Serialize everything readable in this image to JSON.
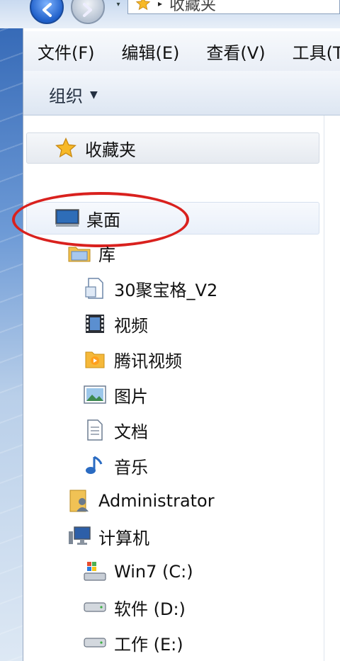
{
  "address": {
    "location": "收藏夹",
    "crumb_arrow": "▸",
    "drop_caret": "▾"
  },
  "menu": {
    "items": [
      {
        "label": "文件(F)"
      },
      {
        "label": "编辑(E)"
      },
      {
        "label": "查看(V)"
      },
      {
        "label": "工具(T"
      }
    ]
  },
  "toolbar": {
    "organize_label": "组织",
    "organize_caret": "▼"
  },
  "navpane": {
    "favorites": {
      "label": "收藏夹",
      "icon": "star-icon"
    },
    "items": [
      {
        "label": "桌面",
        "icon": "desktop-icon",
        "highlighted": true
      },
      {
        "label": "库",
        "icon": "library-folder-icon"
      },
      {
        "label": "30聚宝格_V2",
        "icon": "document-library-icon"
      },
      {
        "label": "视频",
        "icon": "video-icon"
      },
      {
        "label": "腾讯视频",
        "icon": "tencent-video-icon"
      },
      {
        "label": "图片",
        "icon": "picture-icon"
      },
      {
        "label": "文档",
        "icon": "document-icon"
      },
      {
        "label": "音乐",
        "icon": "music-icon"
      },
      {
        "label": "Administrator",
        "icon": "user-folder-icon"
      },
      {
        "label": "计算机",
        "icon": "computer-icon"
      },
      {
        "label": "Win7 (C:)",
        "icon": "system-drive-icon"
      },
      {
        "label": "软件 (D:)",
        "icon": "drive-icon"
      },
      {
        "label": "工作 (E:)",
        "icon": "drive-icon"
      }
    ]
  },
  "colors": {
    "annotation": "#d9211e",
    "frame_blue": "#2f64b3"
  }
}
